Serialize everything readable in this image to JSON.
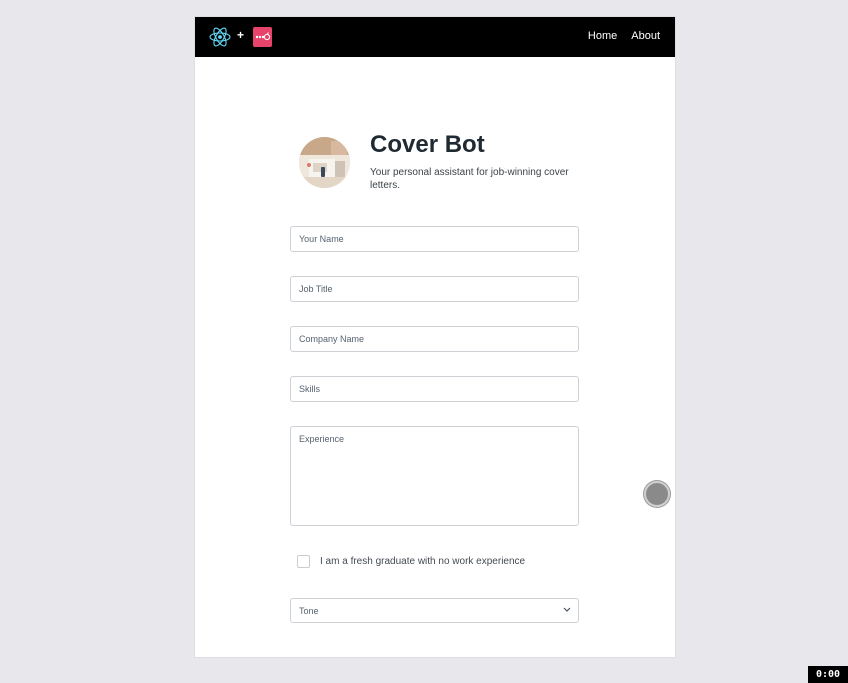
{
  "nav": {
    "plus": "+",
    "links": [
      {
        "label": "Home"
      },
      {
        "label": "About"
      }
    ]
  },
  "hero": {
    "title": "Cover Bot",
    "subtitle": "Your personal assistant for job-winning cover letters."
  },
  "form": {
    "name_placeholder": "Your Name",
    "job_placeholder": "Job Title",
    "company_placeholder": "Company Name",
    "skills_placeholder": "Skills",
    "experience_placeholder": "Experience",
    "fresh_grad_label": "I am a fresh graduate with no work experience",
    "fresh_grad_checked": false,
    "tone_placeholder": "Tone"
  },
  "overlay": {
    "timer": "0:00"
  },
  "colors": {
    "navbar": "#000000",
    "react_logo": "#61dafb",
    "api_logo": "#e8436a",
    "page_bg": "#e8e8ec"
  },
  "icons": {
    "react_logo": "react-logo-icon",
    "api_logo": "api-logo-icon",
    "tone_chevron": "chevron-down-icon"
  }
}
